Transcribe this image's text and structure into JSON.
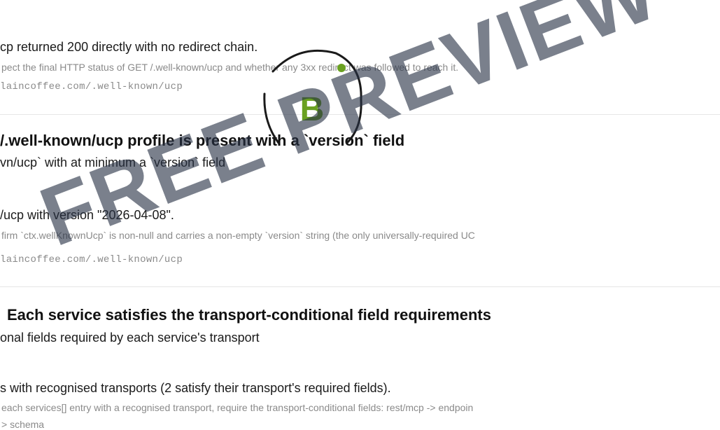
{
  "top_partial": "",
  "check1": {
    "result": "cp returned 200 directly with no redirect chain.",
    "detail": "pect the final HTTP status of GET /.well-known/ucp and whether any 3xx redirect was followed to reach it.",
    "url": "laincoffee.com/.well-known/ucp"
  },
  "check2": {
    "title": "/.well-known/ucp profile is present with a `version` field",
    "subtitle": "vn/ucp` with at minimum a `version` field",
    "result": "/ucp with version \"2026-04-08\".",
    "detail": "firm `ctx.wellKnownUcp` is non-null and carries a non-empty `version` string (the only universally-required UC",
    "url": "laincoffee.com/.well-known/ucp"
  },
  "check3": {
    "title": "Each service satisfies the transport-conditional field requirements",
    "subtitle": "onal fields required by each service's transport",
    "result": "s with recognised transports (2 satisfy their transport's required fields).",
    "detail": "each services[] entry with a recognised transport, require the transport-conditional fields: rest/mcp -> endpoin",
    "detail2": "> schema"
  },
  "watermark": {
    "text": "FREE PREVIEW",
    "badge_letter": "B",
    "text_color": "#283246",
    "badge_color": "#6aa121"
  }
}
